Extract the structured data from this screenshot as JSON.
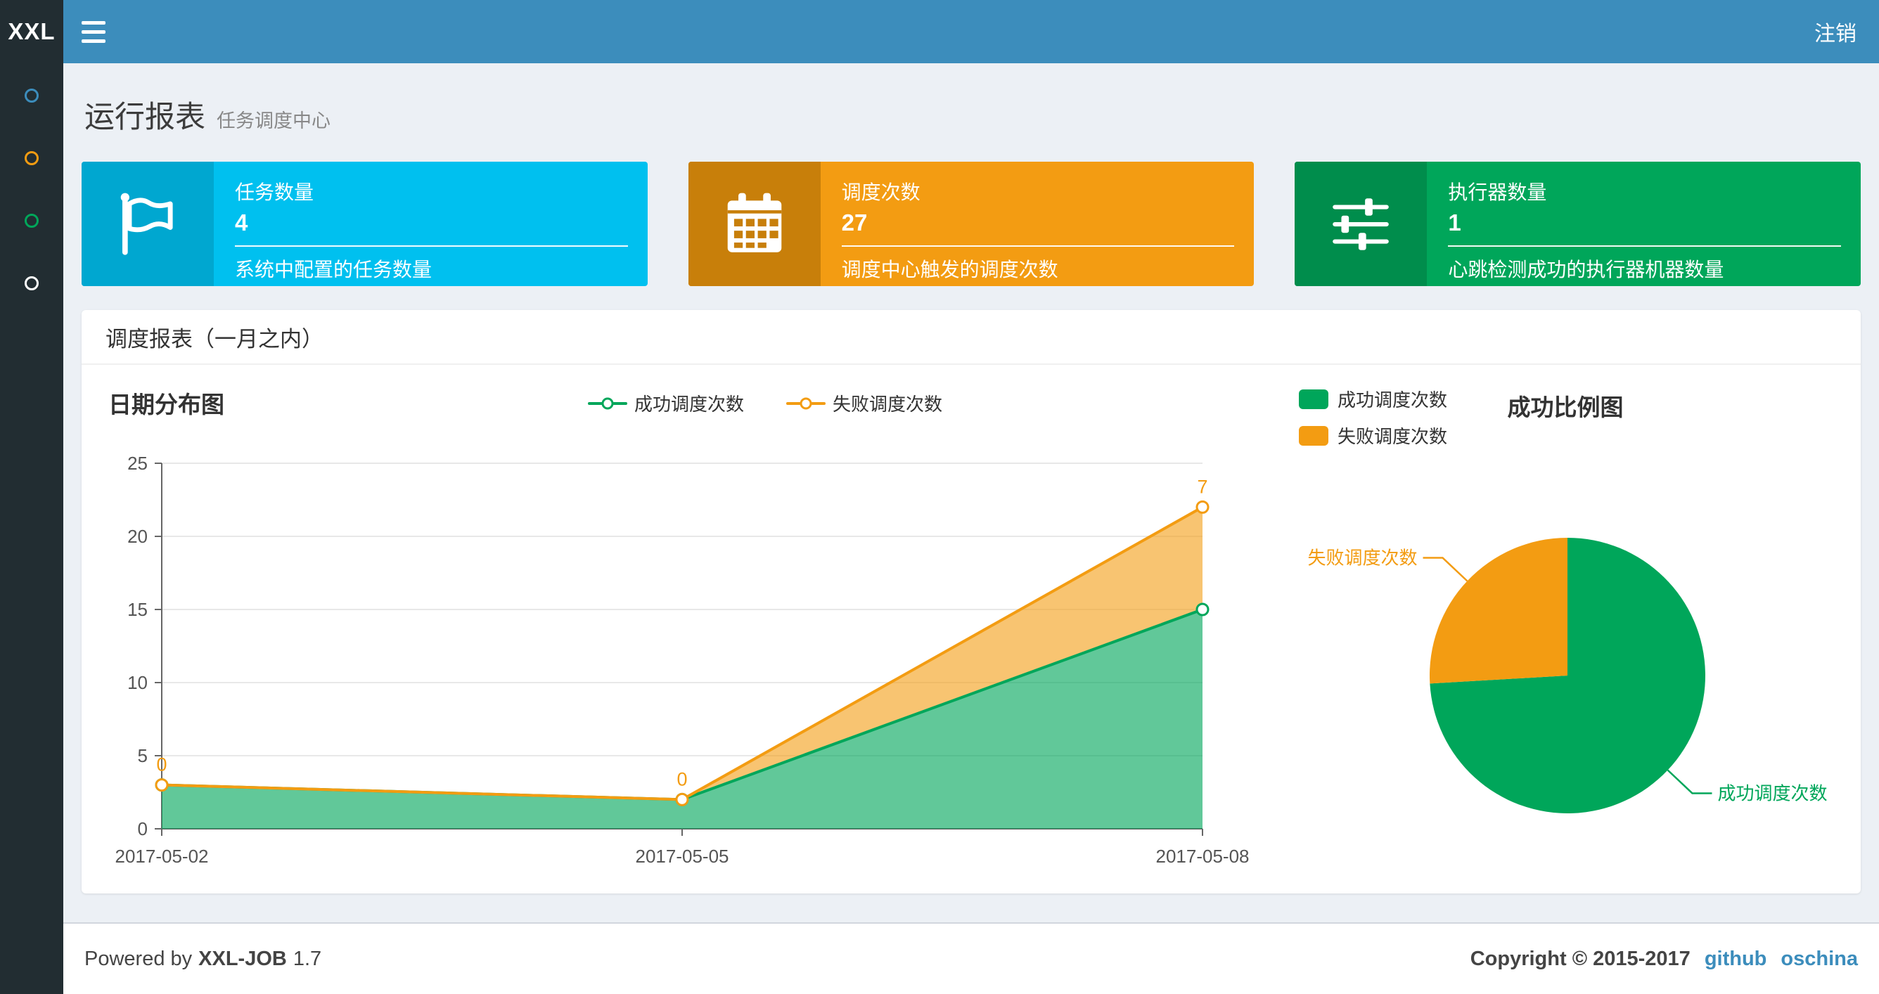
{
  "navbar": {
    "logo": "XXL",
    "logout_label": "注销"
  },
  "sidebar": {
    "items": [
      {
        "name": "dashboard",
        "color": "#3c8dbc"
      },
      {
        "name": "job-manage",
        "color": "#f39c12"
      },
      {
        "name": "job-log",
        "color": "#00a65a"
      },
      {
        "name": "other",
        "color": "#ffffff"
      }
    ]
  },
  "page": {
    "title": "运行报表",
    "subtitle": "任务调度中心"
  },
  "info_boxes": [
    {
      "label": "任务数量",
      "value": "4",
      "desc": "系统中配置的任务数量",
      "icon": "flag-icon",
      "color": "#00c0ef",
      "icon_bg": "#00a7d0"
    },
    {
      "label": "调度次数",
      "value": "27",
      "desc": "调度中心触发的调度次数",
      "icon": "calendar-icon",
      "color": "#f39c12",
      "icon_bg": "#c87f0a"
    },
    {
      "label": "执行器数量",
      "value": "1",
      "desc": "心跳检测成功的执行器机器数量",
      "icon": "sliders-icon",
      "color": "#00a65a",
      "icon_bg": "#008d4c"
    }
  ],
  "panel": {
    "title": "调度报表（一月之内）"
  },
  "chart_data": [
    {
      "type": "area",
      "title": "日期分布图",
      "categories": [
        "2017-05-02",
        "2017-05-05",
        "2017-05-08"
      ],
      "series": [
        {
          "name": "成功调度次数",
          "values": [
            3,
            2,
            15
          ],
          "color": "#00a65a"
        },
        {
          "name": "失败调度次数",
          "values": [
            0,
            0,
            7
          ],
          "color": "#f39c12"
        }
      ],
      "stacked": true,
      "point_labels_series": "失败调度次数",
      "point_labels": [
        "0",
        "0",
        "7"
      ],
      "ylim": [
        0,
        25
      ],
      "yticks": [
        0,
        5,
        10,
        15,
        20,
        25
      ],
      "grid": true,
      "legend_position": "top-center"
    },
    {
      "type": "pie",
      "title": "成功比例图",
      "slices": [
        {
          "name": "成功调度次数",
          "value": 20,
          "color": "#00a65a"
        },
        {
          "name": "失败调度次数",
          "value": 7,
          "color": "#f39c12"
        }
      ],
      "legend_position": "top-left"
    }
  ],
  "footer": {
    "powered_by_prefix": "Powered by",
    "app_name": "XXL-JOB",
    "version": "1.7",
    "copyright": "Copyright © 2015-2017",
    "links": [
      {
        "label": "github"
      },
      {
        "label": "oschina"
      }
    ]
  }
}
